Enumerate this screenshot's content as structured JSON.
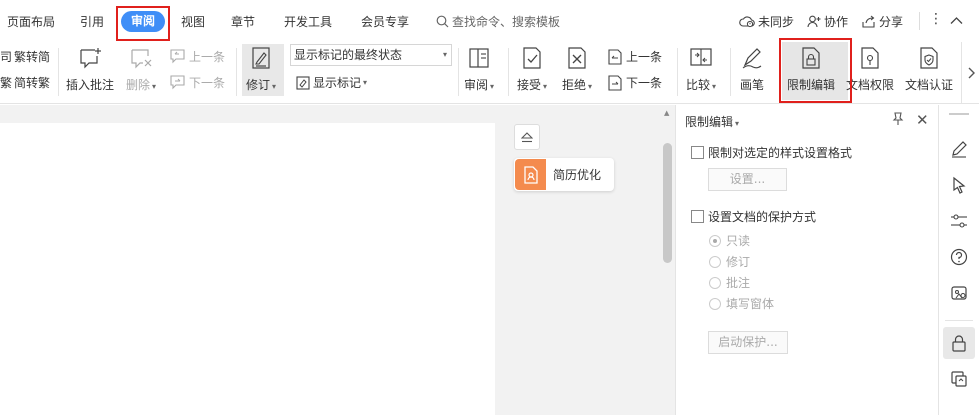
{
  "menu": {
    "tabs": [
      "页面布局",
      "引用",
      "审阅",
      "视图",
      "章节",
      "开发工具",
      "会员专享"
    ],
    "active_tab": "审阅",
    "search_label": "查找命令、搜索模板",
    "sync_label": "未同步",
    "collab_label": "协作",
    "share_label": "分享"
  },
  "ribbon": {
    "trad_label": "繁转简",
    "simp_label": "简转繁",
    "insert_comment": "插入批注",
    "delete": "删除",
    "prev_comment": "上一条",
    "next_comment": "下一条",
    "track_changes": "修订",
    "markup_dropdown": "显示标记的最终状态",
    "show_markup": "显示标记",
    "review": "审阅",
    "accept": "接受",
    "reject": "拒绝",
    "prev_change": "上一条",
    "next_change": "下一条",
    "compare": "比较",
    "pen": "画笔",
    "restrict_edit": "限制编辑",
    "doc_permission": "文档权限",
    "doc_cert": "文档认证"
  },
  "doc": {
    "resume_label": "简历优化"
  },
  "panel": {
    "title": "限制编辑",
    "format_restrict_label": "限制对选定的样式设置格式",
    "settings_button": "设置...",
    "protect_label": "设置文档的保护方式",
    "options": [
      "只读",
      "修订",
      "批注",
      "填写窗体"
    ],
    "selected_option": "只读",
    "start_protect_button": "启动保护..."
  },
  "colors": {
    "accent": "#3f8ef7",
    "highlight_red": "#e0201c",
    "resume_orange": "#f48b4e"
  }
}
